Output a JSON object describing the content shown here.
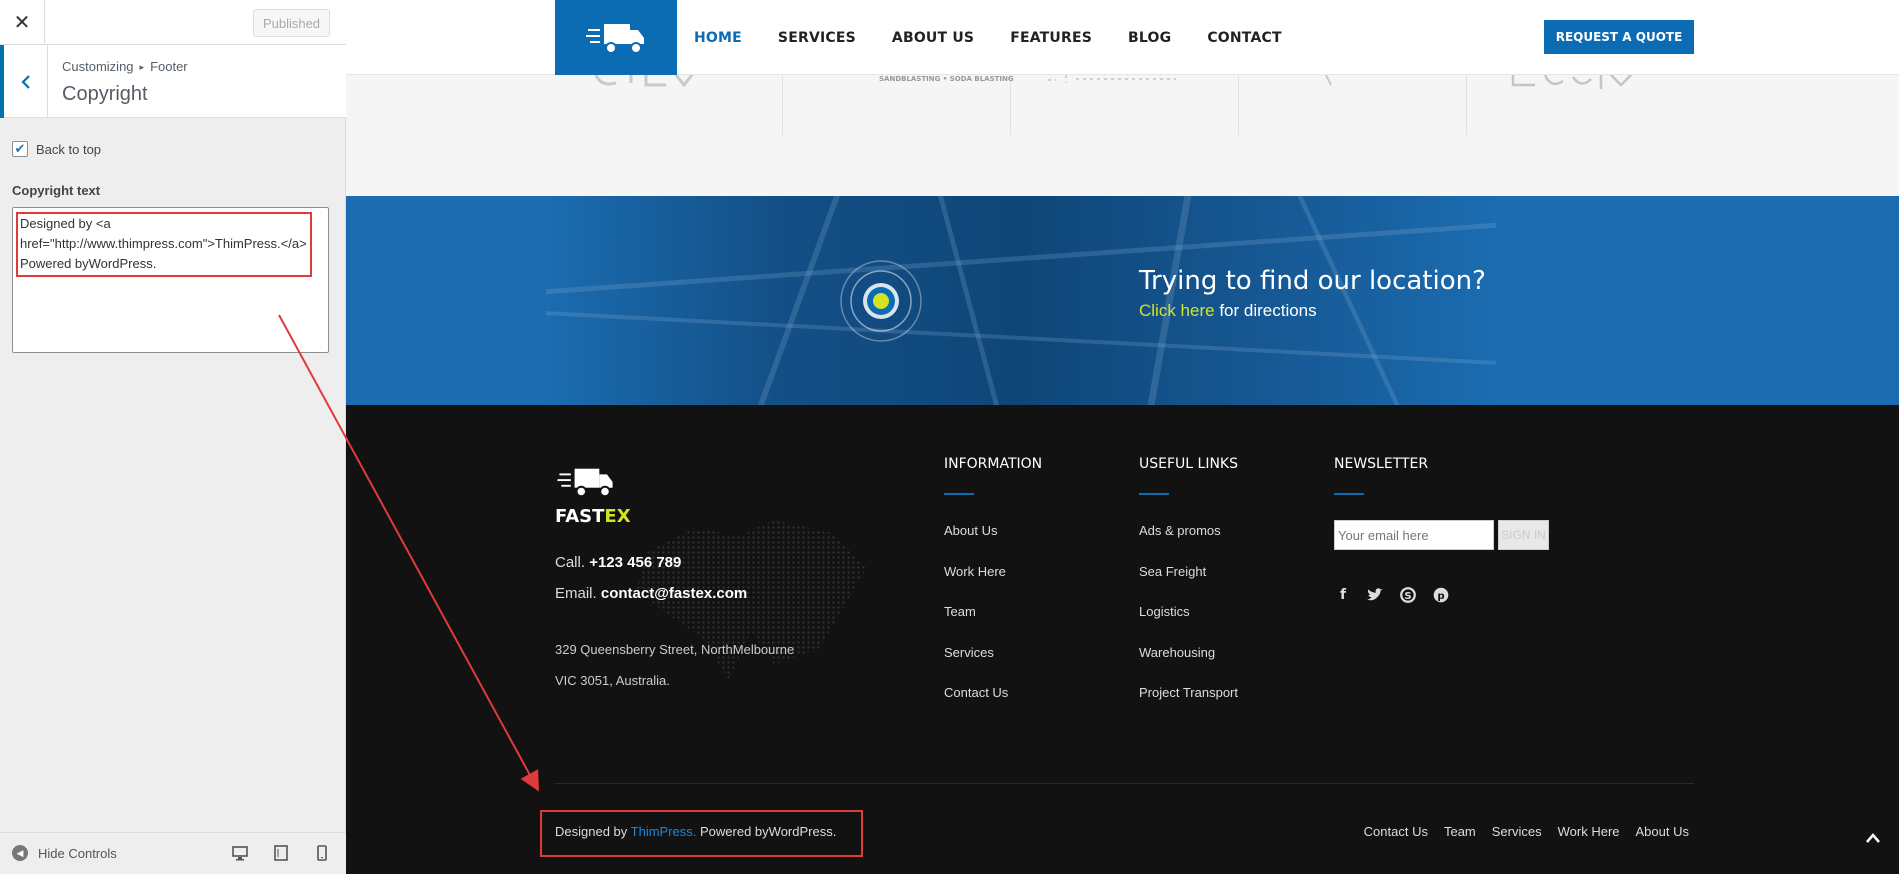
{
  "customizer": {
    "close_icon": "close-icon",
    "publish_label": "Published",
    "breadcrumb": [
      "Customizing",
      "Footer"
    ],
    "section_title": "Copyright",
    "back_to_top_label": "Back to top",
    "back_to_top_checked": true,
    "copyright_label": "Copyright text",
    "copyright_value": "Designed by <a href=\"http://www.thimpress.com\">ThimPress.</a> Powered byWordPress.",
    "hide_controls_label": "Hide Controls",
    "devices": [
      "desktop-icon",
      "tablet-icon",
      "mobile-icon"
    ]
  },
  "site": {
    "nav": [
      "HOME",
      "SERVICES",
      "ABOUT US",
      "FEATURES",
      "BLOG",
      "CONTACT"
    ],
    "active_nav": "HOME",
    "quote_label": "REQUEST A QUOTE",
    "partner_text": "SANDBLASTING • SODA BLASTING",
    "location_title": "Trying to find our location?",
    "location_link": "Click here",
    "location_rest": " for directions",
    "brand_a": "FAST",
    "brand_b": "EX",
    "call_label": "Call.",
    "call_value": "+123 456 789",
    "email_label": "Email.",
    "email_value": "contact@fastex.com",
    "address_1": "329 Queensberry Street, NorthMelbourne",
    "address_2": "VIC 3051, Australia.",
    "columns": [
      {
        "title": "INFORMATION",
        "links": [
          "About Us",
          "Work Here",
          "Team",
          "Services",
          "Contact Us"
        ]
      },
      {
        "title": "USEFUL LINKS",
        "links": [
          "Ads & promos",
          "Sea Freight",
          "Logistics",
          "Warehousing",
          "Project Transport"
        ]
      }
    ],
    "newsletter_title": "NEWSLETTER",
    "newsletter_placeholder": "Your email here",
    "newsletter_button": "SIGN IN",
    "socials": [
      "facebook-icon",
      "twitter-icon",
      "skype-icon",
      "pinterest-icon"
    ],
    "copyright_prefix": "Designed by ",
    "copyright_link": "ThimPress.",
    "copyright_suffix": " Powered byWordPress.",
    "bottom_links": [
      "Contact Us",
      "Team",
      "Services",
      "Work Here",
      "About Us"
    ]
  },
  "colors": {
    "brand_blue": "#0b6cb4",
    "accent_yellow": "#d4e325",
    "annotation_red": "#e03b3b"
  }
}
